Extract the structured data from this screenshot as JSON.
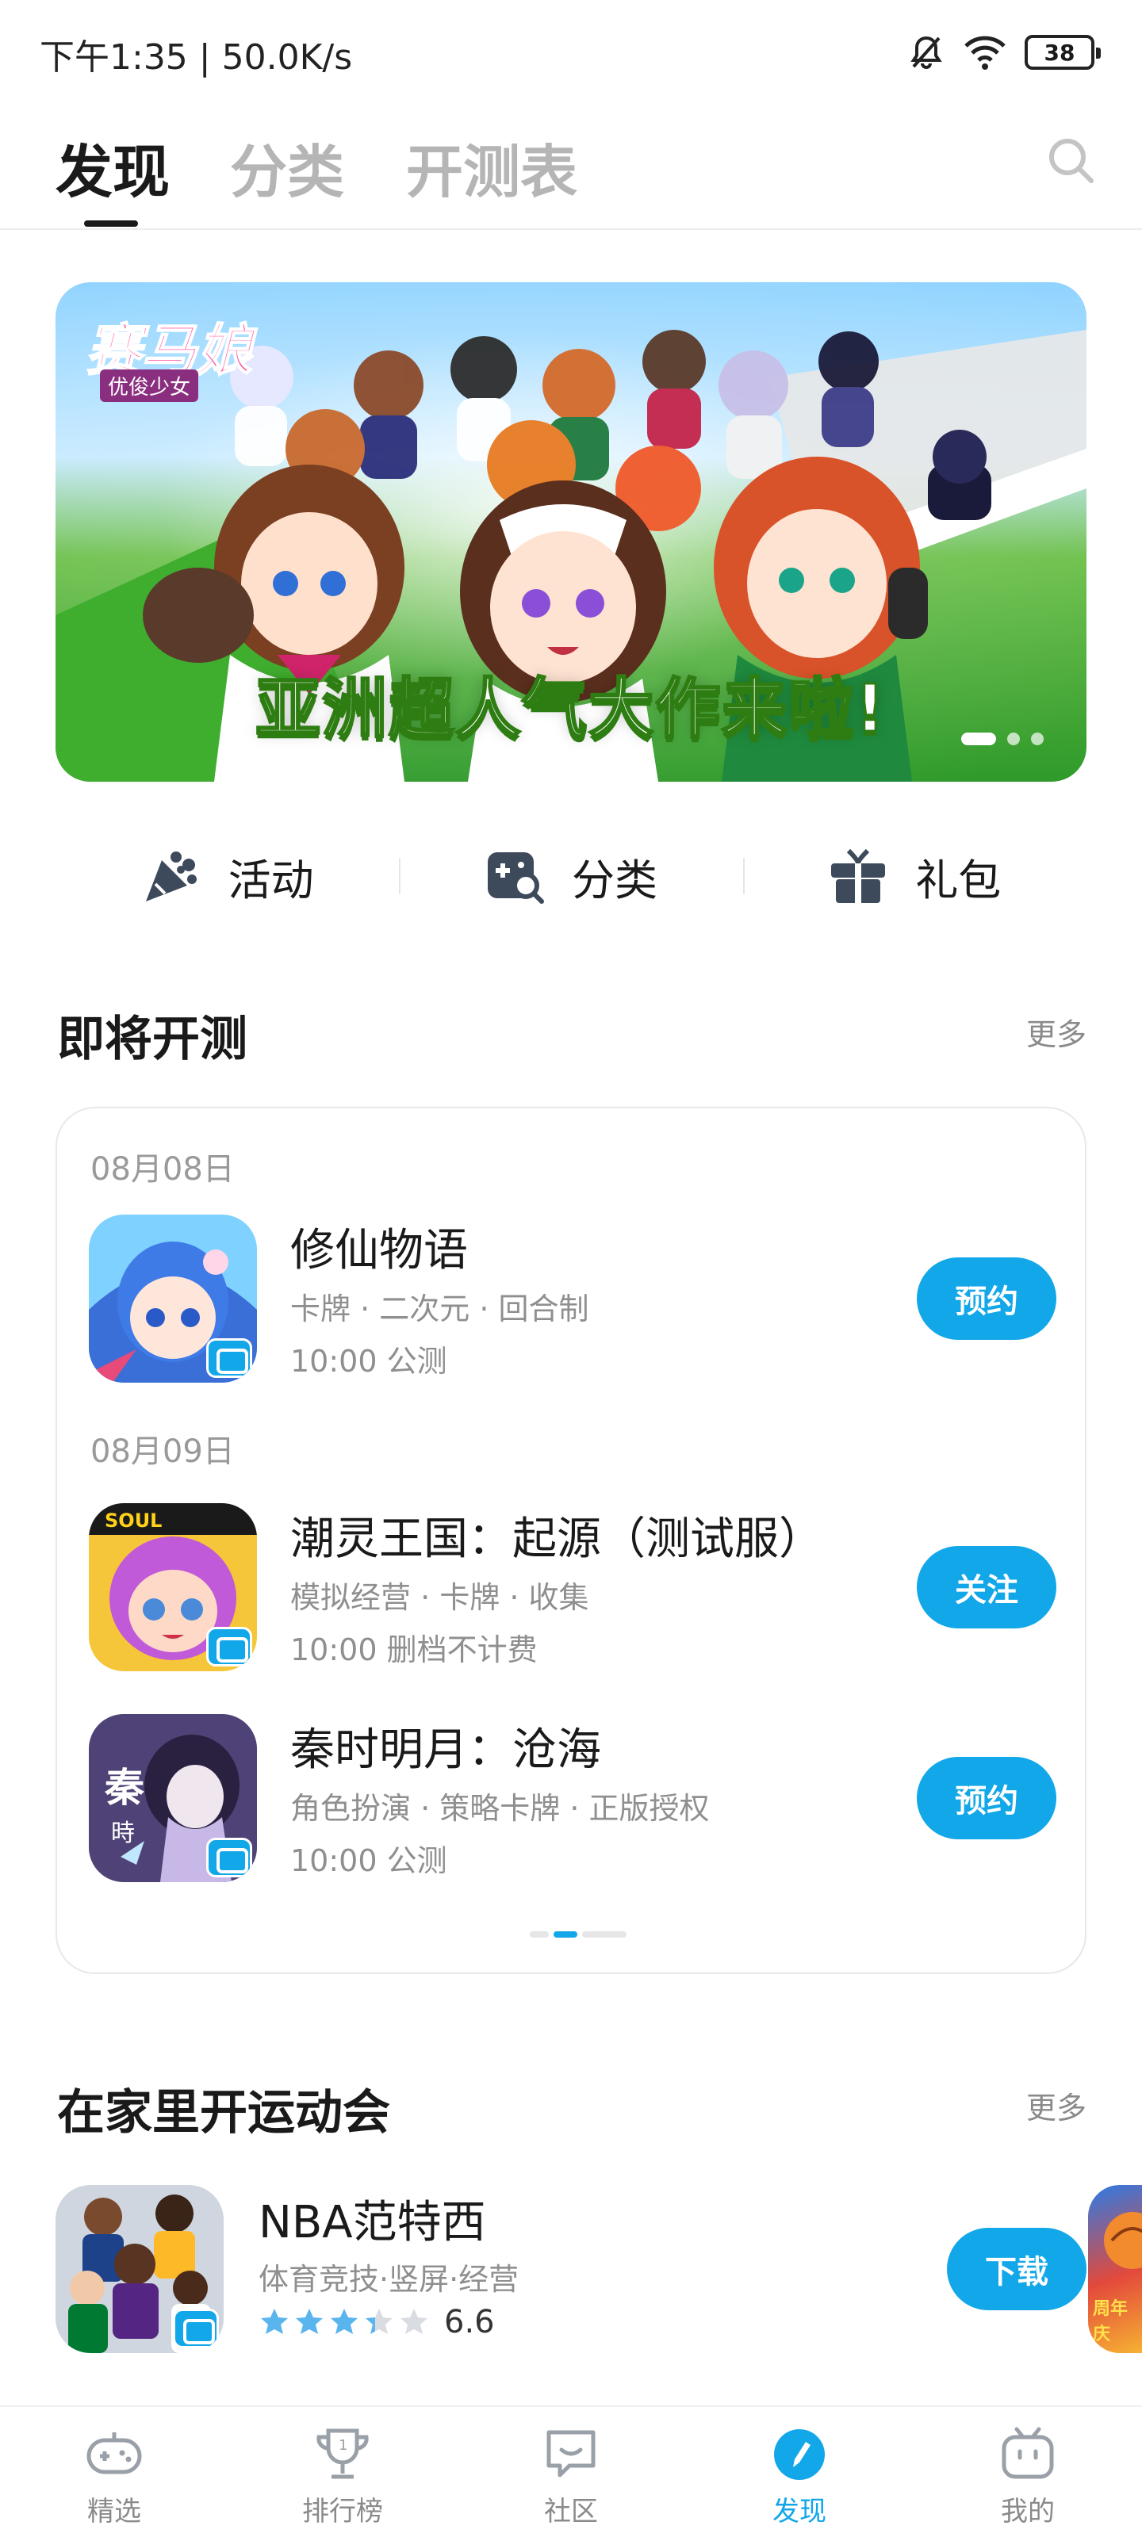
{
  "status_bar": {
    "time_speed": "下午1:35 | 50.0K/s",
    "battery": "38",
    "icons": [
      "bell-muted-icon",
      "wifi-icon",
      "battery-icon"
    ]
  },
  "top_tabs": {
    "tabs": [
      {
        "label": "发现",
        "active": true
      },
      {
        "label": "分类",
        "active": false
      },
      {
        "label": "开测表",
        "active": false
      }
    ],
    "search_icon": "search-icon"
  },
  "banner": {
    "logo_text": "赛马娘",
    "logo_sub": "优俊少女",
    "slogan": "亚洲超人气大作来啦!",
    "dots": 3,
    "active_dot": 0
  },
  "quick_links": [
    {
      "label": "活动",
      "icon": "party-popper-icon"
    },
    {
      "label": "分类",
      "icon": "gamepad-search-icon"
    },
    {
      "label": "礼包",
      "icon": "gift-icon"
    }
  ],
  "upcoming": {
    "title": "即将开测",
    "more": "更多",
    "groups": [
      {
        "date": "08月08日",
        "games": [
          {
            "name": "修仙物语",
            "tags": "卡牌 · 二次元 · 回合制",
            "time": "10:00 公测",
            "action": "预约"
          }
        ]
      },
      {
        "date": "08月09日",
        "games": [
          {
            "name": "潮灵王国：起源（测试服）",
            "tags": "模拟经营 · 卡牌 · 收集",
            "time": "10:00 删档不计费",
            "action": "关注"
          },
          {
            "name": "秦时明月：沧海",
            "tags": "角色扮演 · 策略卡牌 · 正版授权",
            "time": "10:00 公测",
            "action": "预约"
          }
        ]
      }
    ],
    "pager_active": 1
  },
  "sports": {
    "title": "在家里开运动会",
    "more": "更多",
    "game": {
      "name": "NBA范特西",
      "tags": "体育竞技·竖屏·经营",
      "rating": "6.6",
      "stars": 3.3,
      "action": "下载"
    },
    "next_peek_text": "周年庆"
  },
  "bottom_nav": [
    {
      "label": "精选",
      "icon": "gamepad-icon",
      "active": false
    },
    {
      "label": "排行榜",
      "icon": "trophy-icon",
      "active": false
    },
    {
      "label": "社区",
      "icon": "chat-smile-icon",
      "active": false
    },
    {
      "label": "发现",
      "icon": "compass-icon",
      "active": true
    },
    {
      "label": "我的",
      "icon": "tv-face-icon",
      "active": false
    }
  ],
  "colors": {
    "accent": "#12a7e8",
    "text_primary": "#1a1a1a",
    "text_secondary": "#8f8f8f",
    "tab_inactive": "#b5b5b5"
  }
}
